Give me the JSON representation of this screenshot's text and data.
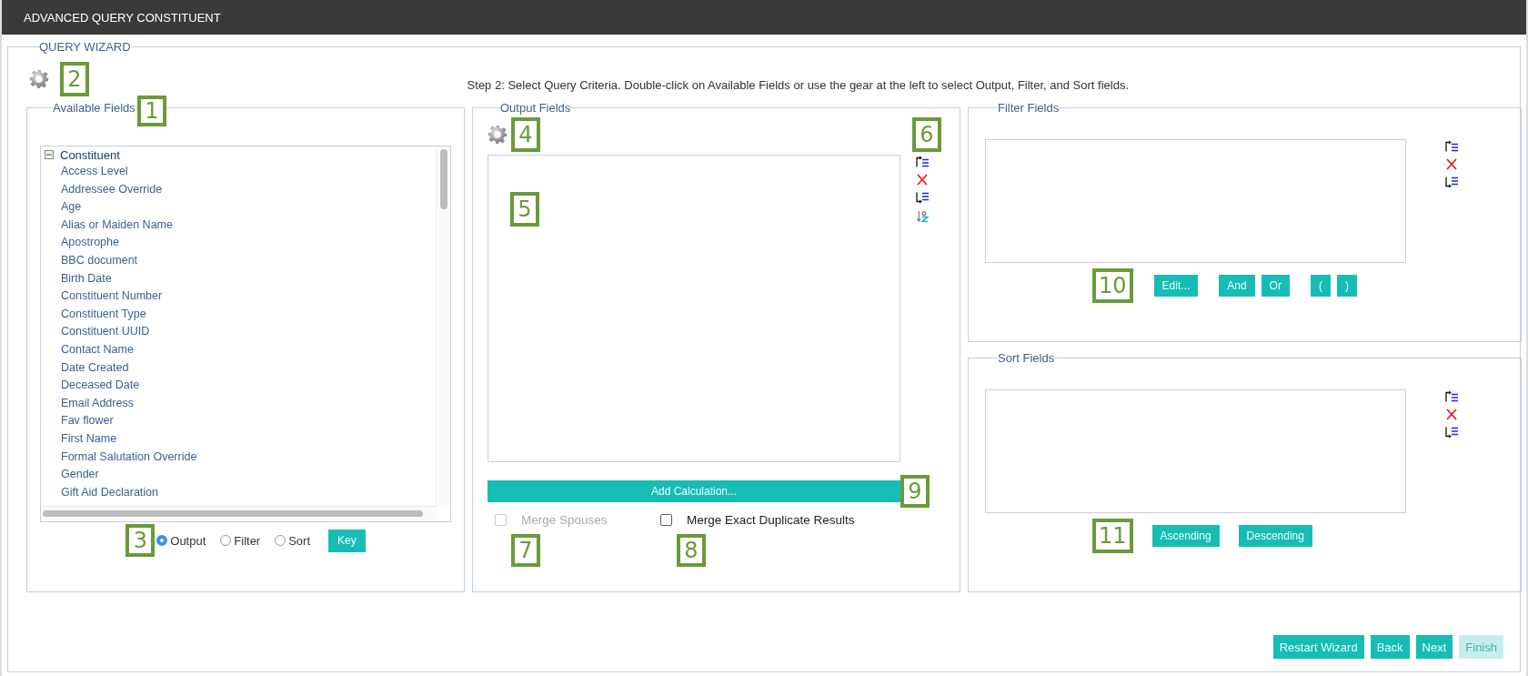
{
  "window": {
    "title": "ADVANCED QUERY CONSTITUENT"
  },
  "wizard": {
    "legend": "QUERY WIZARD",
    "callout": "2",
    "instruction": "Step 2: Select Query Criteria. Double-click on Available Fields or use the gear at the left to select Output, Filter, and Sort fields."
  },
  "available_fields": {
    "legend": "Available Fields",
    "callout": "1",
    "tree": {
      "label": "Constituent",
      "expanded": true,
      "children": [
        {
          "label": "Access Level"
        },
        {
          "label": "Addressee Override"
        },
        {
          "label": "Age"
        },
        {
          "label": "Alias or Maiden Name"
        },
        {
          "label": "Apostrophe"
        },
        {
          "label": "BBC document"
        },
        {
          "label": "Birth Date"
        },
        {
          "label": "Constituent Number"
        },
        {
          "label": "Constituent Type"
        },
        {
          "label": "Constituent UUID"
        },
        {
          "label": "Contact Name"
        },
        {
          "label": "Date Created"
        },
        {
          "label": "Deceased Date"
        },
        {
          "label": "Email Address"
        },
        {
          "label": "Fav flower"
        },
        {
          "label": "First Name"
        },
        {
          "label": "Formal Salutation Override"
        },
        {
          "label": "Gender"
        },
        {
          "label": "Gift Aid Declaration"
        }
      ]
    },
    "modes_callout": "3",
    "modes": [
      {
        "label": "Output",
        "selected": true
      },
      {
        "label": "Filter",
        "selected": false
      },
      {
        "label": "Sort",
        "selected": false
      }
    ],
    "key_button": "Key"
  },
  "output_fields": {
    "legend": "Output Fields",
    "gear_callout": "4",
    "list_callout": "5",
    "tools_callout": "6",
    "add_calculation": "Add Calculation...",
    "add_callout": "9",
    "options": [
      {
        "label": "Merge Spouses",
        "checked": false,
        "disabled": true,
        "callout": "7"
      },
      {
        "label": "Merge Exact Duplicate Results",
        "checked": false,
        "disabled": false,
        "callout": "8"
      }
    ]
  },
  "filter_fields": {
    "legend": "Filter Fields",
    "callout": "10",
    "button_groups": [
      [
        "Edit..."
      ],
      [
        "And",
        "Or"
      ],
      [
        "(",
        ")"
      ]
    ]
  },
  "sort_fields": {
    "legend": "Sort Fields",
    "callout": "11",
    "buttons": [
      "Ascending",
      "Descending"
    ]
  },
  "footer_buttons": [
    {
      "label": "Restart Wizard",
      "disabled": false
    },
    {
      "label": "Back",
      "disabled": false
    },
    {
      "label": "Next",
      "disabled": false
    },
    {
      "label": "Finish",
      "disabled": true
    }
  ]
}
